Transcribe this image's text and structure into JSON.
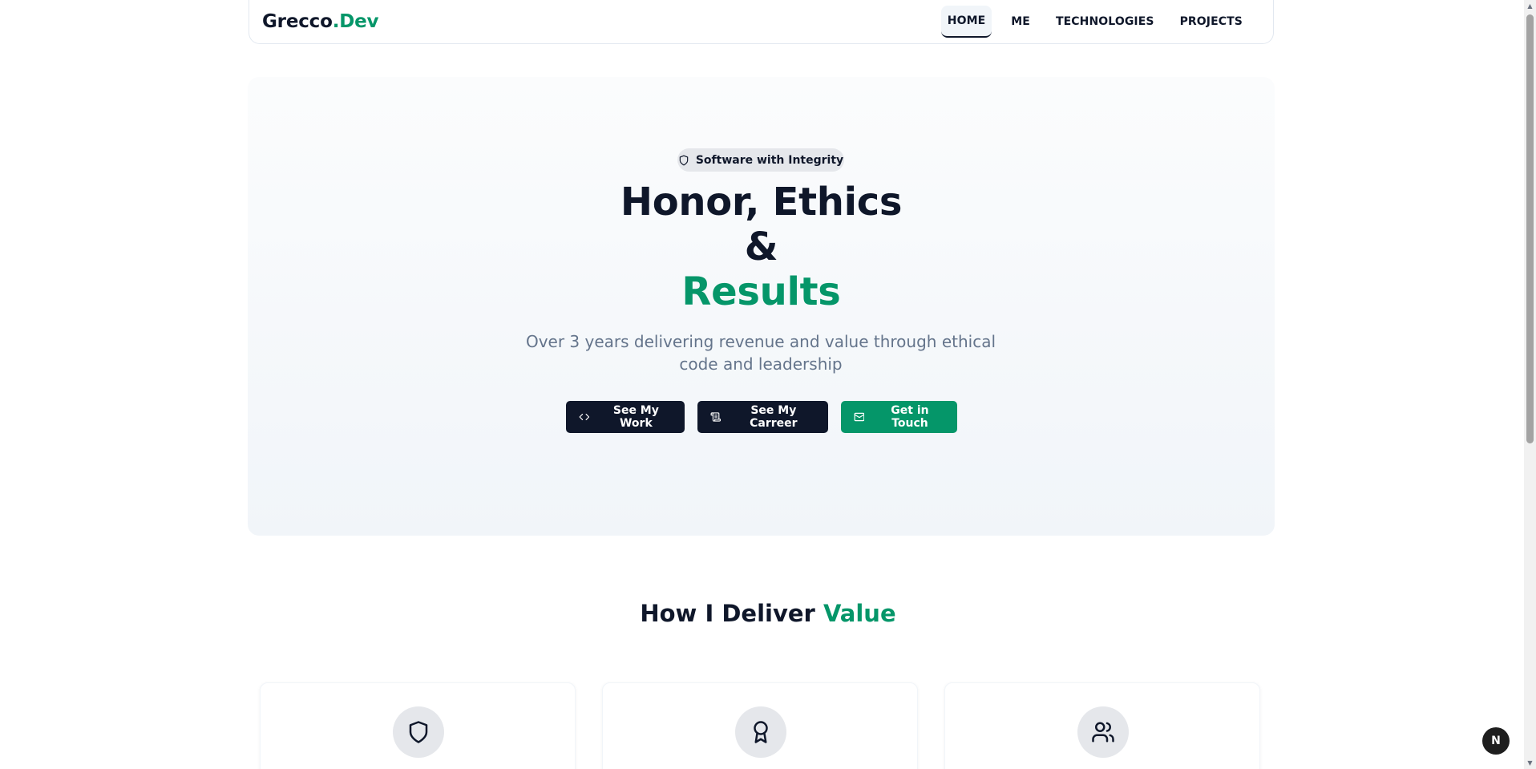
{
  "brand": {
    "name_part1": "Grecco",
    "name_part2": ".Dev"
  },
  "nav": {
    "items": [
      {
        "label": "HOME",
        "active": true
      },
      {
        "label": "ME",
        "active": false
      },
      {
        "label": "TECHNOLOGIES",
        "active": false
      },
      {
        "label": "PROJECTS",
        "active": false
      }
    ]
  },
  "hero": {
    "badge": {
      "label": "Software with Integrity",
      "icon": "shield-icon"
    },
    "title_line1": "Honor, Ethics",
    "title_line2": "&",
    "title_line3": "Results",
    "subtitle": "Over 3 years delivering revenue and value through ethical code and leadership",
    "buttons": {
      "work": {
        "label": "See My Work",
        "icon": "code-icon"
      },
      "career": {
        "label": "See My Carreer",
        "icon": "scroll-icon"
      },
      "touch": {
        "label": "Get in Touch",
        "icon": "mail-icon"
      }
    }
  },
  "value_section": {
    "title_part1": "How I Deliver",
    "title_part2": "Value",
    "cards": [
      {
        "icon": "shield-icon"
      },
      {
        "icon": "award-icon"
      },
      {
        "icon": "users-icon"
      }
    ]
  },
  "dev_badge": {
    "label": "N"
  },
  "colors": {
    "accent": "#059669",
    "dark": "#0f172a",
    "muted": "#64748b",
    "hero_bg": "#f1f5f9"
  }
}
